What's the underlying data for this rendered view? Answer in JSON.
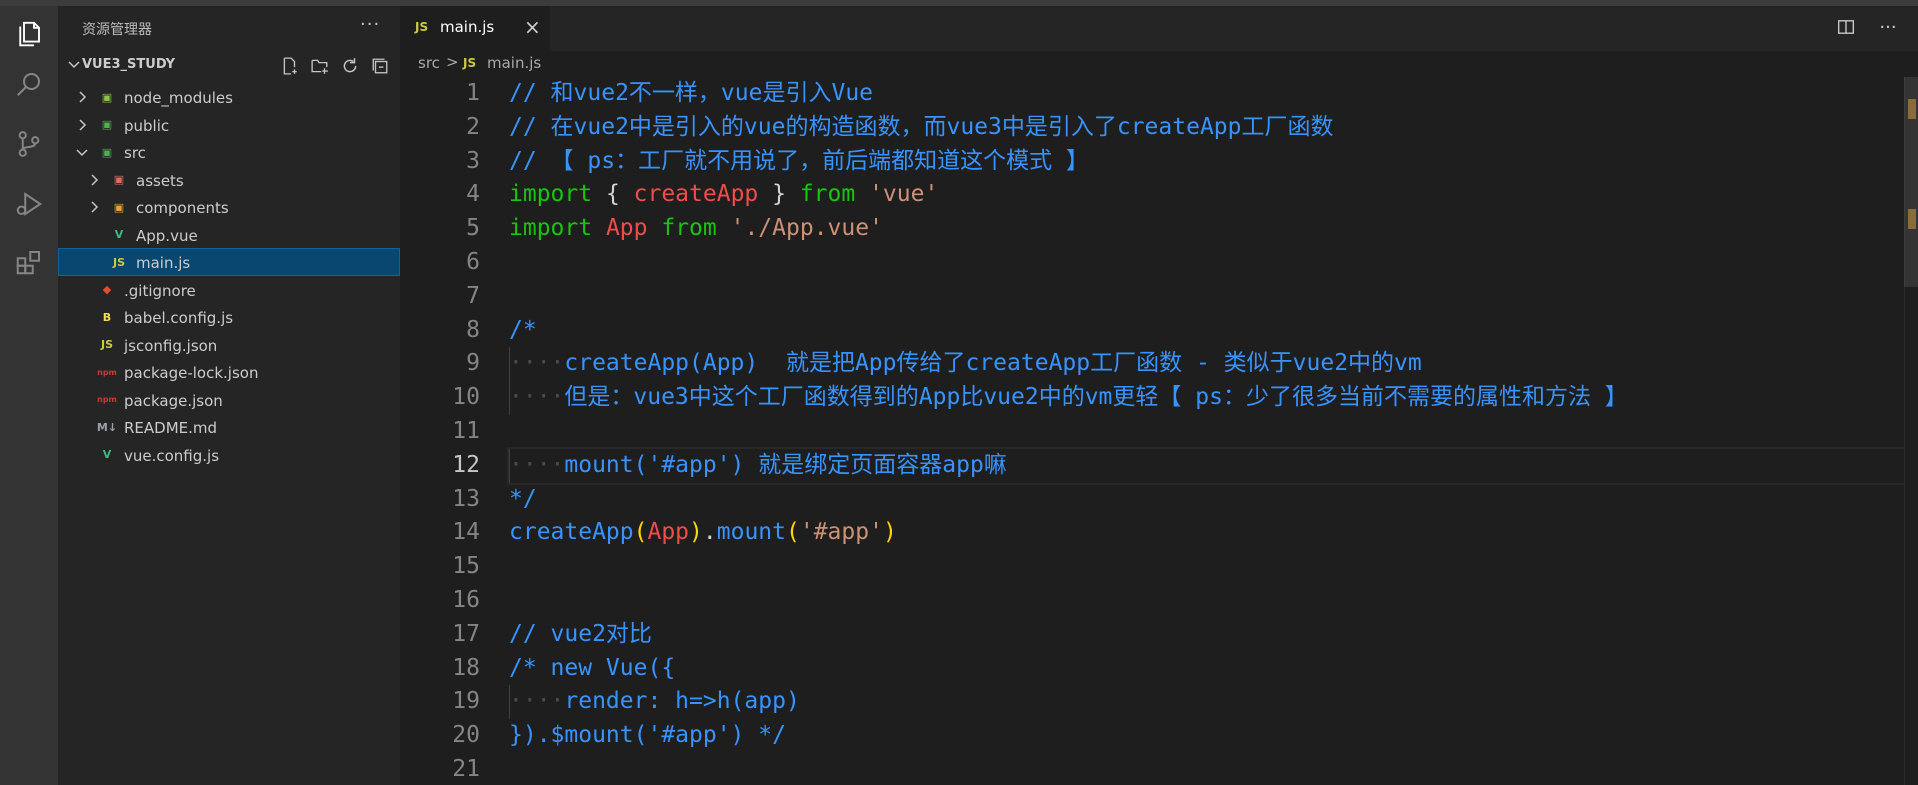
{
  "sidebar": {
    "title": "资源管理器",
    "more": "···",
    "project": "VUE3_STUDY",
    "items": [
      {
        "label": "node_modules",
        "kind": "folder",
        "depth": 0,
        "expanded": false,
        "icon": "node-folder-icon"
      },
      {
        "label": "public",
        "kind": "folder",
        "depth": 0,
        "expanded": false,
        "icon": "public-folder-icon"
      },
      {
        "label": "src",
        "kind": "folder",
        "depth": 0,
        "expanded": true,
        "icon": "src-folder-icon"
      },
      {
        "label": "assets",
        "kind": "folder",
        "depth": 1,
        "expanded": false,
        "icon": "assets-folder-icon"
      },
      {
        "label": "components",
        "kind": "folder",
        "depth": 1,
        "expanded": false,
        "icon": "components-folder-icon"
      },
      {
        "label": "App.vue",
        "kind": "file",
        "depth": 1,
        "icon": "vue-file-icon"
      },
      {
        "label": "main.js",
        "kind": "file",
        "depth": 1,
        "icon": "js-file-icon",
        "selected": true
      },
      {
        "label": ".gitignore",
        "kind": "file",
        "depth": 0,
        "icon": "git-file-icon"
      },
      {
        "label": "babel.config.js",
        "kind": "file",
        "depth": 0,
        "icon": "babel-file-icon"
      },
      {
        "label": "jsconfig.json",
        "kind": "file",
        "depth": 0,
        "icon": "json-file-icon"
      },
      {
        "label": "package-lock.json",
        "kind": "file",
        "depth": 0,
        "icon": "npm-file-icon"
      },
      {
        "label": "package.json",
        "kind": "file",
        "depth": 0,
        "icon": "npm-file-icon"
      },
      {
        "label": "README.md",
        "kind": "file",
        "depth": 0,
        "icon": "markdown-file-icon"
      },
      {
        "label": "vue.config.js",
        "kind": "file",
        "depth": 0,
        "icon": "vue-config-file-icon"
      }
    ]
  },
  "tab": {
    "badge": "JS",
    "label": "main.js",
    "close": "×"
  },
  "breadcrumb": {
    "folder": "src",
    "separator": ">",
    "badge": "JS",
    "file": "main.js"
  },
  "editor": {
    "active_line": 12,
    "lines": [
      {
        "n": "1",
        "tokens": [
          [
            "comment",
            "// 和vue2不一样，vue是引入Vue"
          ]
        ]
      },
      {
        "n": "2",
        "tokens": [
          [
            "comment",
            "// 在vue2中是引入的vue的构造函数，而vue3中是引入了createApp工厂函数"
          ]
        ]
      },
      {
        "n": "3",
        "tokens": [
          [
            "comment",
            "// 【 ps：工厂就不用说了，前后端都知道这个模式 】"
          ]
        ]
      },
      {
        "n": "4",
        "tokens": [
          [
            "green",
            "import"
          ],
          [
            "white",
            " { "
          ],
          [
            "red",
            "createApp"
          ],
          [
            "white",
            " } "
          ],
          [
            "green",
            "from"
          ],
          [
            "white",
            " "
          ],
          [
            "str",
            "'vue'"
          ]
        ]
      },
      {
        "n": "5",
        "tokens": [
          [
            "green",
            "import"
          ],
          [
            "white",
            " "
          ],
          [
            "red",
            "App"
          ],
          [
            "white",
            " "
          ],
          [
            "green",
            "from"
          ],
          [
            "white",
            " "
          ],
          [
            "str",
            "'./App.vue'"
          ]
        ]
      },
      {
        "n": "6",
        "tokens": []
      },
      {
        "n": "7",
        "tokens": []
      },
      {
        "n": "8",
        "tokens": [
          [
            "comment",
            "/*"
          ]
        ]
      },
      {
        "n": "9",
        "tokens": [
          [
            "dot",
            "····"
          ],
          [
            "comment",
            "createApp(App)  就是把App传给了createApp工厂函数 - 类似于vue2中的vm"
          ]
        ]
      },
      {
        "n": "10",
        "tokens": [
          [
            "dot",
            "····"
          ],
          [
            "comment",
            "但是：vue3中这个工厂函数得到的App比vue2中的vm更轻【 ps：少了很多当前不需要的属性和方法 】"
          ]
        ]
      },
      {
        "n": "11",
        "tokens": []
      },
      {
        "n": "12",
        "tokens": [
          [
            "dot",
            "····"
          ],
          [
            "comment",
            "mount('#app') 就是绑定页面容器app嘛"
          ]
        ]
      },
      {
        "n": "13",
        "tokens": [
          [
            "comment",
            "*/"
          ]
        ]
      },
      {
        "n": "14",
        "tokens": [
          [
            "blue",
            "createApp"
          ],
          [
            "yellow",
            "("
          ],
          [
            "red",
            "App"
          ],
          [
            "yellow",
            ")"
          ],
          [
            "white",
            "."
          ],
          [
            "blue",
            "mount"
          ],
          [
            "yellow",
            "("
          ],
          [
            "str",
            "'#app'"
          ],
          [
            "yellow",
            ")"
          ]
        ]
      },
      {
        "n": "15",
        "tokens": []
      },
      {
        "n": "16",
        "tokens": []
      },
      {
        "n": "17",
        "tokens": [
          [
            "comment",
            "// vue2对比"
          ]
        ]
      },
      {
        "n": "18",
        "tokens": [
          [
            "comment",
            "/* new Vue({"
          ]
        ]
      },
      {
        "n": "19",
        "tokens": [
          [
            "dot",
            "····"
          ],
          [
            "comment",
            "render: h=>h(app)"
          ]
        ]
      },
      {
        "n": "20",
        "tokens": [
          [
            "comment",
            "}).$mount('#app') */"
          ]
        ]
      },
      {
        "n": "21",
        "tokens": []
      }
    ]
  },
  "colors": {
    "comment": "#3794ff",
    "keyword": "#16c60c",
    "identifier": "#f14c4c",
    "string": "#ce9178",
    "selection": "#094771",
    "js_badge": "#cbcb41"
  }
}
